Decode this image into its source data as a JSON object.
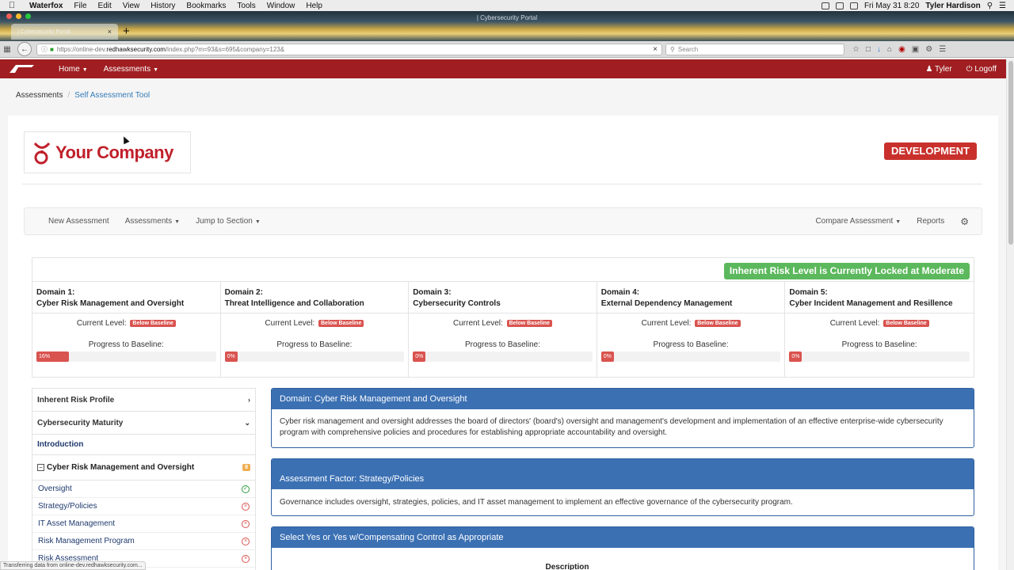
{
  "menubar": {
    "app": "Waterfox",
    "items": [
      "File",
      "Edit",
      "View",
      "History",
      "Bookmarks",
      "Tools",
      "Window",
      "Help"
    ],
    "datetime": "Fri May 31  8:20",
    "user": "Tyler Hardison"
  },
  "browser": {
    "window_title": "| Cybersecurity Portal",
    "tab_title": "| Cybersecurity Portal",
    "url_prefix": "https://online-dev.",
    "url_host": "redhawksecurity.com",
    "url_path": "/index.php?m=93&s=695&company=123&",
    "search_placeholder": "Search"
  },
  "navbar": {
    "items": [
      {
        "label": "Home"
      },
      {
        "label": "Assessments"
      }
    ],
    "user_label": "Tyler",
    "logoff_label": "Logoff",
    "color": "#a01e21"
  },
  "breadcrumb": {
    "items": [
      "Assessments",
      "Self Assessment Tool"
    ]
  },
  "brand": {
    "name": "Your Company",
    "env_badge": "DEVELOPMENT"
  },
  "subnav": {
    "new_assessment": "New Assessment",
    "assessments": "Assessments",
    "jump_to_section": "Jump to Section",
    "compare_assessment": "Compare Assessment",
    "reports": "Reports"
  },
  "risk_banner": "Inherent Risk Level is Currently Locked at Moderate",
  "domain_labels": {
    "current_level": "Current Level:",
    "progress_label": "Progress to Baseline:"
  },
  "domains": [
    {
      "number": "Domain 1:",
      "name": "Cyber Risk Management and Oversight",
      "level": "Below Baseline",
      "progress_text": "16%",
      "progress": 16
    },
    {
      "number": "Domain 2:",
      "name": "Threat Intelligence and Collaboration",
      "level": "Below Baseline",
      "progress_text": "0%",
      "progress": 0
    },
    {
      "number": "Domain 3:",
      "name": "Cybersecurity Controls",
      "level": "Below Baseline",
      "progress_text": "0%",
      "progress": 0
    },
    {
      "number": "Domain 4:",
      "name": "External Dependency Management",
      "level": "Below Baseline",
      "progress_text": "0%",
      "progress": 0
    },
    {
      "number": "Domain 5:",
      "name": "Cyber Incident Management and Resillence",
      "level": "Below Baseline",
      "progress_text": "0%",
      "progress": 0
    }
  ],
  "sidebar": {
    "inherent_risk_profile": "Inherent Risk Profile",
    "cybersecurity_maturity": "Cybersecurity Maturity",
    "introduction": "Introduction",
    "section_title": "Cyber Risk Management and Oversight",
    "section_count": "8",
    "items": [
      {
        "label": "Oversight",
        "status": "complete"
      },
      {
        "label": "Strategy/Policies",
        "status": "incomplete"
      },
      {
        "label": "IT Asset Management",
        "status": "incomplete"
      },
      {
        "label": "Risk Management Program",
        "status": "incomplete"
      },
      {
        "label": "Risk Assessment",
        "status": "incomplete"
      }
    ]
  },
  "cards": {
    "domain_title": "Domain: Cyber Risk Management and Oversight",
    "domain_text": "Cyber risk management and oversight addresses the board of directors' (board's) oversight and management's development and implementation of an effective enterprise-wide cybersecurity program with comprehensive policies and procedures for establishing appropriate accountability and oversight.",
    "factor_title": "Assessment Factor: Strategy/Policies",
    "factor_text": "Governance includes oversight, strategies, policies, and IT asset management to implement an effective governance of the cybersecurity program.",
    "select_title": "Select Yes or Yes w/Compensating Control as Appropriate",
    "description_header": "Description"
  },
  "statusbar": "Transferring data from online-dev.redhawksecurity.com..."
}
